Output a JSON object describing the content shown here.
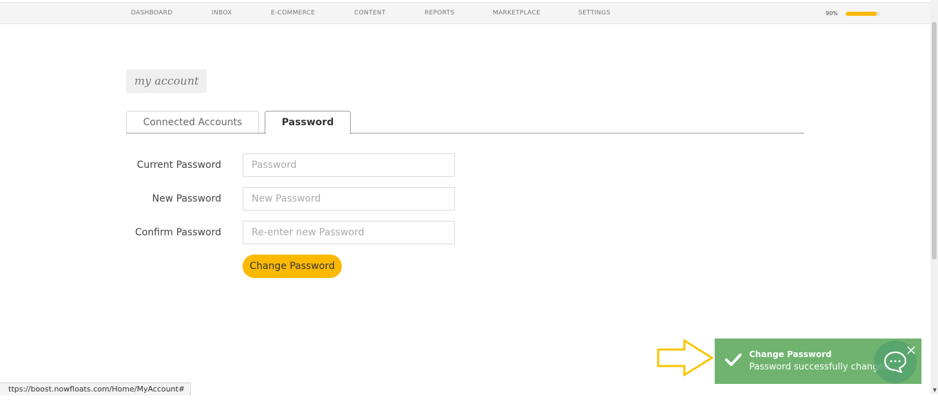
{
  "nav": {
    "items": [
      {
        "label": "DASHBOARD"
      },
      {
        "label": "INBOX"
      },
      {
        "label": "E-COMMERCE"
      },
      {
        "label": "CONTENT"
      },
      {
        "label": "REPORTS"
      },
      {
        "label": "MARKETPLACE"
      },
      {
        "label": "SETTINGS"
      }
    ],
    "progress_label": "90%",
    "progress_fraction": 0.9,
    "accent_color": "#fbb900"
  },
  "page": {
    "title": "my account"
  },
  "tabs": [
    {
      "label": "Connected Accounts",
      "active": false
    },
    {
      "label": "Password",
      "active": true
    }
  ],
  "form": {
    "current": {
      "label": "Current Password",
      "placeholder": "Password",
      "value": ""
    },
    "new": {
      "label": "New Password",
      "placeholder": "New Password",
      "value": ""
    },
    "confirm": {
      "label": "Confirm Password",
      "placeholder": "Re-enter new Password",
      "value": ""
    },
    "submit_label": "Change Password"
  },
  "statusbar": {
    "url": "ttps://boost.nowfloats.com/Home/MyAccount#"
  },
  "toast": {
    "title": "Change Password",
    "message": "Password successfully changed.",
    "color": "#6fb36f",
    "icon": "check-icon"
  },
  "icons": {
    "close": "close-icon",
    "chat": "chat-icon",
    "arrow": "arrow-right-icon"
  }
}
